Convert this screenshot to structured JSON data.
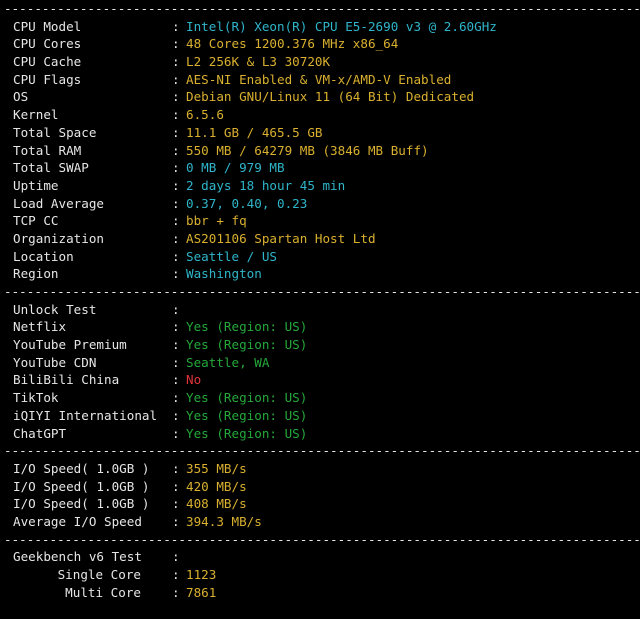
{
  "divider": "------------------------------------------------------------------------------------------",
  "sysinfo": [
    {
      "label": "CPU Model",
      "value": "Intel(R) Xeon(R) CPU E5-2690 v3 @ 2.60GHz",
      "color": "cyan"
    },
    {
      "label": "CPU Cores",
      "value": "48 Cores 1200.376 MHz x86_64",
      "color": "yellow"
    },
    {
      "label": "CPU Cache",
      "value": "L2 256K & L3 30720K",
      "color": "yellow"
    },
    {
      "label": "CPU Flags",
      "value": "AES-NI Enabled & VM-x/AMD-V Enabled",
      "color": "yellow"
    },
    {
      "label": "OS",
      "value": "Debian GNU/Linux 11 (64 Bit) Dedicated",
      "color": "yellow"
    },
    {
      "label": "Kernel",
      "value": "6.5.6",
      "color": "yellow"
    },
    {
      "label": "Total Space",
      "value": "11.1 GB / 465.5 GB",
      "color": "yellow"
    },
    {
      "label": "Total RAM",
      "value": "550 MB / 64279 MB (3846 MB Buff)",
      "color": "yellow"
    },
    {
      "label": "Total SWAP",
      "value": "0 MB / 979 MB",
      "color": "cyan"
    },
    {
      "label": "Uptime",
      "value": "2 days 18 hour 45 min",
      "color": "cyan"
    },
    {
      "label": "Load Average",
      "value": "0.37, 0.40, 0.23",
      "color": "cyan"
    },
    {
      "label": "TCP CC",
      "value": "bbr + fq",
      "color": "yellow"
    },
    {
      "label": "Organization",
      "value": "AS201106 Spartan Host Ltd",
      "color": "yellow"
    },
    {
      "label": "Location",
      "value": "Seattle / US",
      "color": "cyan"
    },
    {
      "label": "Region",
      "value": "Washington",
      "color": "cyan"
    }
  ],
  "unlock": [
    {
      "label": "Unlock Test",
      "value": "",
      "color": "white"
    },
    {
      "label": "Netflix",
      "value": "Yes (Region: US)",
      "color": "green"
    },
    {
      "label": "YouTube Premium",
      "value": "Yes (Region: US)",
      "color": "green"
    },
    {
      "label": "YouTube CDN",
      "value": "Seattle, WA",
      "color": "green"
    },
    {
      "label": "BiliBili China",
      "value": "No",
      "color": "red"
    },
    {
      "label": "TikTok",
      "value": "Yes (Region: US)",
      "color": "green"
    },
    {
      "label": "iQIYI International",
      "value": "Yes (Region: US)",
      "color": "green"
    },
    {
      "label": "ChatGPT",
      "value": "Yes (Region: US)",
      "color": "green"
    }
  ],
  "io": [
    {
      "label": "I/O Speed( 1.0GB )",
      "value": "355 MB/s",
      "color": "yellow"
    },
    {
      "label": "I/O Speed( 1.0GB )",
      "value": "420 MB/s",
      "color": "yellow"
    },
    {
      "label": "I/O Speed( 1.0GB )",
      "value": "408 MB/s",
      "color": "yellow"
    },
    {
      "label": "Average I/O Speed",
      "value": "394.3 MB/s",
      "color": "yellow"
    }
  ],
  "geekbench": {
    "title": "Geekbench v6 Test",
    "rows": [
      {
        "label": "Single Core",
        "value": "1123",
        "color": "yellow"
      },
      {
        "label": "Multi Core",
        "value": "7861",
        "color": "yellow"
      }
    ]
  },
  "separator": ":"
}
